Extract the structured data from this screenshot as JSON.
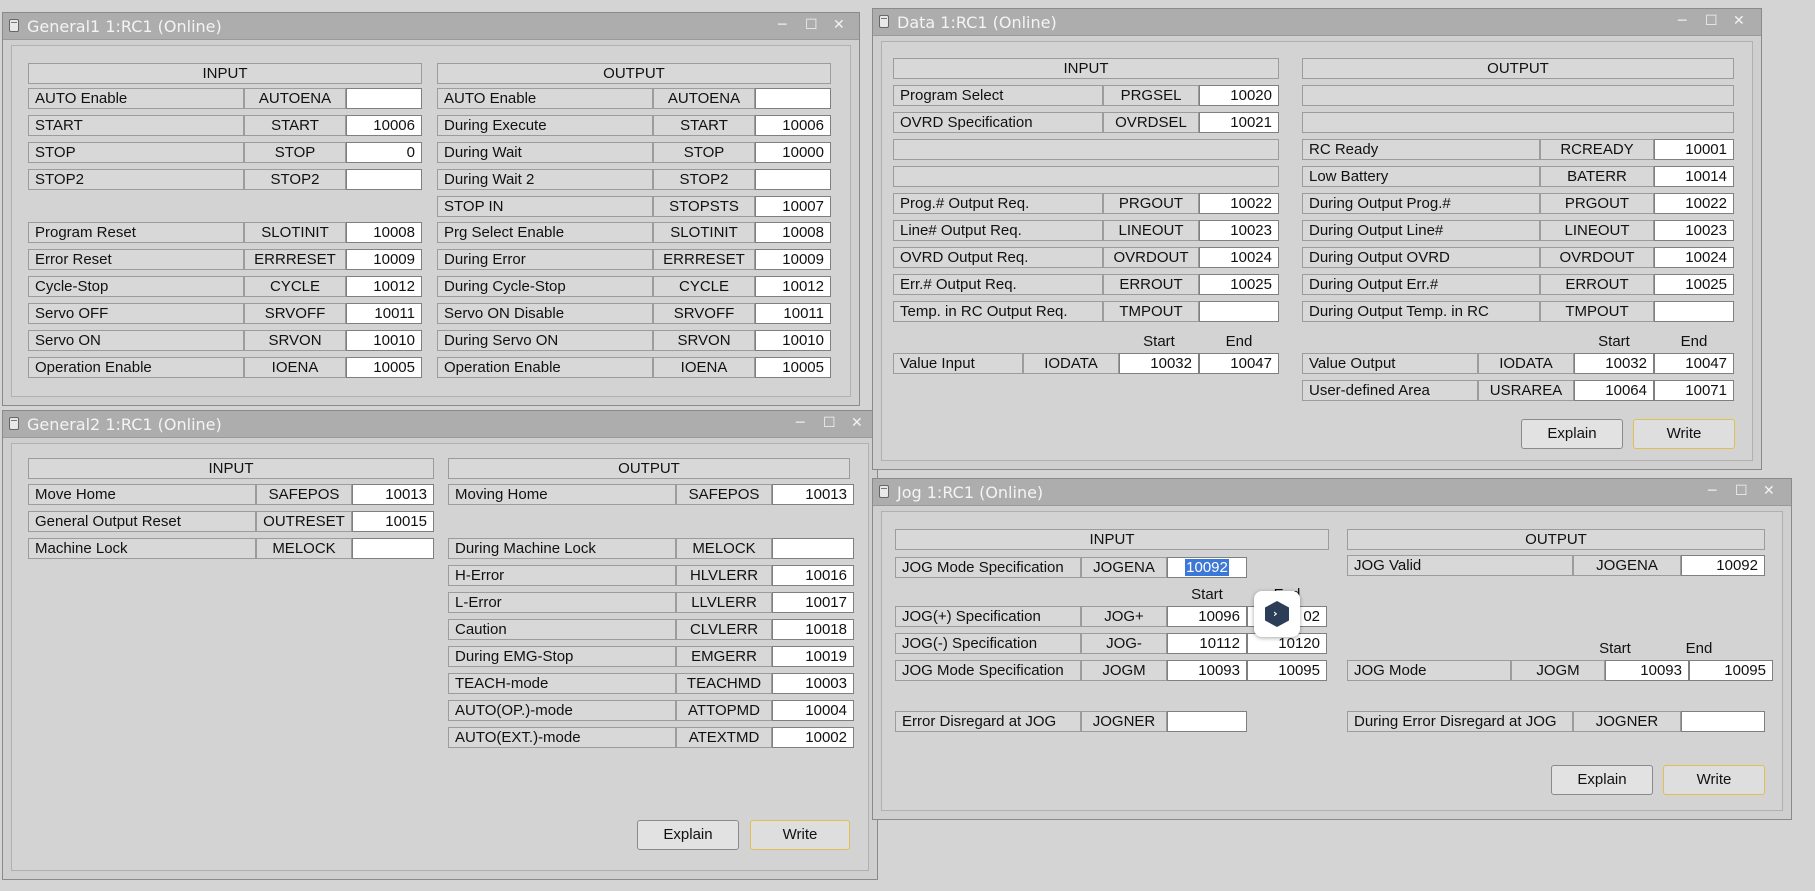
{
  "common": {
    "minimize": "─",
    "maximize": "☐",
    "close": "✕"
  },
  "general1": {
    "title": "General1 1:RC1  (Online)",
    "input_header": "INPUT",
    "output_header": "OUTPUT",
    "inputs": [
      {
        "label": "AUTO Enable",
        "signal": "AUTOENA",
        "value": ""
      },
      {
        "label": "START",
        "signal": "START",
        "value": "10006"
      },
      {
        "label": "STOP",
        "signal": "STOP",
        "value": "0"
      },
      {
        "label": "STOP2",
        "signal": "STOP2",
        "value": ""
      },
      {
        "label": "Program Reset",
        "signal": "SLOTINIT",
        "value": "10008"
      },
      {
        "label": "Error Reset",
        "signal": "ERRRESET",
        "value": "10009"
      },
      {
        "label": "Cycle-Stop",
        "signal": "CYCLE",
        "value": "10012"
      },
      {
        "label": "Servo OFF",
        "signal": "SRVOFF",
        "value": "10011"
      },
      {
        "label": "Servo ON",
        "signal": "SRVON",
        "value": "10010"
      },
      {
        "label": "Operation Enable",
        "signal": "IOENA",
        "value": "10005"
      }
    ],
    "outputs": [
      {
        "label": "AUTO Enable",
        "signal": "AUTOENA",
        "value": ""
      },
      {
        "label": "During Execute",
        "signal": "START",
        "value": "10006"
      },
      {
        "label": "During Wait",
        "signal": "STOP",
        "value": "10000"
      },
      {
        "label": "During Wait 2",
        "signal": "STOP2",
        "value": ""
      },
      {
        "label": "STOP IN",
        "signal": "STOPSTS",
        "value": "10007"
      },
      {
        "label": "Prg Select Enable",
        "signal": "SLOTINIT",
        "value": "10008"
      },
      {
        "label": "During Error",
        "signal": "ERRRESET",
        "value": "10009"
      },
      {
        "label": "During Cycle-Stop",
        "signal": "CYCLE",
        "value": "10012"
      },
      {
        "label": "Servo ON Disable",
        "signal": "SRVOFF",
        "value": "10011"
      },
      {
        "label": "During Servo ON",
        "signal": "SRVON",
        "value": "10010"
      },
      {
        "label": "Operation Enable",
        "signal": "IOENA",
        "value": "10005"
      }
    ]
  },
  "general2": {
    "title": "General2 1:RC1  (Online)",
    "input_header": "INPUT",
    "output_header": "OUTPUT",
    "inputs": [
      {
        "label": "Move Home",
        "signal": "SAFEPOS",
        "value": "10013"
      },
      {
        "label": "General Output Reset",
        "signal": "OUTRESET",
        "value": "10015"
      },
      {
        "label": "Machine Lock",
        "signal": "MELOCK",
        "value": ""
      }
    ],
    "outputs": [
      {
        "label": "Moving Home",
        "signal": "SAFEPOS",
        "value": "10013"
      },
      {
        "label": "During Machine Lock",
        "signal": "MELOCK",
        "value": ""
      },
      {
        "label": "H-Error",
        "signal": "HLVLERR",
        "value": "10016"
      },
      {
        "label": "L-Error",
        "signal": "LLVLERR",
        "value": "10017"
      },
      {
        "label": "Caution",
        "signal": "CLVLERR",
        "value": "10018"
      },
      {
        "label": "During EMG-Stop",
        "signal": "EMGERR",
        "value": "10019"
      },
      {
        "label": "TEACH-mode",
        "signal": "TEACHMD",
        "value": "10003"
      },
      {
        "label": "AUTO(OP.)-mode",
        "signal": "ATTOPMD",
        "value": "10004"
      },
      {
        "label": "AUTO(EXT.)-mode",
        "signal": "ATEXTMD",
        "value": "10002"
      }
    ],
    "explain": "Explain",
    "write": "Write"
  },
  "data1": {
    "title": "Data 1:RC1  (Online)",
    "input_header": "INPUT",
    "output_header": "OUTPUT",
    "inputs": [
      {
        "label": "Program Select",
        "signal": "PRGSEL",
        "value": "10020"
      },
      {
        "label": "OVRD Specification",
        "signal": "OVRDSEL",
        "value": "10021"
      },
      {
        "label": "Prog.# Output Req.",
        "signal": "PRGOUT",
        "value": "10022"
      },
      {
        "label": "Line# Output Req.",
        "signal": "LINEOUT",
        "value": "10023"
      },
      {
        "label": "OVRD Output Req.",
        "signal": "OVRDOUT",
        "value": "10024"
      },
      {
        "label": "Err.# Output Req.",
        "signal": "ERROUT",
        "value": "10025"
      },
      {
        "label": "Temp. in RC Output Req.",
        "signal": "TMPOUT",
        "value": ""
      }
    ],
    "outputs": [
      {
        "label": "RC Ready",
        "signal": "RCREADY",
        "value": "10001"
      },
      {
        "label": "Low Battery",
        "signal": "BATERR",
        "value": "10014"
      },
      {
        "label": "During Output Prog.#",
        "signal": "PRGOUT",
        "value": "10022"
      },
      {
        "label": "During Output Line#",
        "signal": "LINEOUT",
        "value": "10023"
      },
      {
        "label": "During Output OVRD",
        "signal": "OVRDOUT",
        "value": "10024"
      },
      {
        "label": "During Output Err.#",
        "signal": "ERROUT",
        "value": "10025"
      },
      {
        "label": "During Output Temp. in RC",
        "signal": "TMPOUT",
        "value": ""
      }
    ],
    "start_label": "Start",
    "end_label": "End",
    "value_input": {
      "label": "Value Input",
      "signal": "IODATA",
      "start": "10032",
      "end": "10047"
    },
    "value_output": {
      "label": "Value Output",
      "signal": "IODATA",
      "start": "10032",
      "end": "10047"
    },
    "user_area": {
      "label": "User-defined Area",
      "signal": "USRAREA",
      "start": "10064",
      "end": "10071"
    },
    "explain": "Explain",
    "write": "Write"
  },
  "jog": {
    "title": "Jog  1:RC1  (Online)",
    "input_header": "INPUT",
    "output_header": "OUTPUT",
    "mode_spec": {
      "label": "JOG Mode Specification",
      "signal": "JOGENA",
      "value": "10092"
    },
    "start_label": "Start",
    "end_label": "End",
    "jog_plus": {
      "label": "JOG(+) Specification",
      "signal": "JOG+",
      "start": "10096",
      "end": "02"
    },
    "jog_minus": {
      "label": "JOG(-) Specification",
      "signal": "JOG-",
      "start": "10112",
      "end": "10120"
    },
    "jog_mode_in": {
      "label": "JOG Mode Specification",
      "signal": "JOGM",
      "start": "10093",
      "end": "10095"
    },
    "err_disregard": {
      "label": "Error Disregard at JOG",
      "signal": "JOGNER",
      "value": ""
    },
    "jog_valid": {
      "label": "JOG Valid",
      "signal": "JOGENA",
      "value": "10092"
    },
    "jog_mode_out": {
      "label": "JOG Mode",
      "signal": "JOGM",
      "start": "10093",
      "end": "10095"
    },
    "during_err_disregard": {
      "label": "During Error Disregard at JOG",
      "signal": "JOGNER",
      "value": ""
    },
    "explain": "Explain",
    "write": "Write"
  }
}
